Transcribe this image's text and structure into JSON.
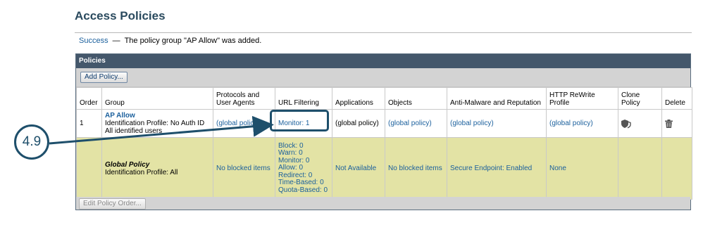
{
  "page": {
    "title": "Access Policies"
  },
  "notice": {
    "label": "Success",
    "separator": "—",
    "message": "The policy group \"AP Allow\" was added."
  },
  "panel": {
    "title": "Policies",
    "add_button": "Add Policy...",
    "edit_order_button": "Edit Policy Order..."
  },
  "table": {
    "columns": {
      "order": "Order",
      "group": "Group",
      "protocols_line1": "Protocols and",
      "protocols_line2": "User Agents",
      "url_filtering": "URL Filtering",
      "applications": "Applications",
      "objects": "Objects",
      "anti_malware": "Anti-Malware and Reputation",
      "http_rewrite": "HTTP ReWrite Profile",
      "clone": "Clone Policy",
      "delete": "Delete"
    },
    "rows": [
      {
        "order": "1",
        "group_name": "AP Allow",
        "identification": "Identification Profile: No Auth ID",
        "users": "All identified users",
        "protocols": "(global policy)",
        "url_filtering": "Monitor: 1",
        "applications": "(global policy)",
        "objects": "(global policy)",
        "anti_malware": "(global policy)",
        "http_rewrite": "(global policy)",
        "clone_icon": "clone-shield-icon",
        "delete_icon": "trash-icon"
      },
      {
        "group_name": "Global Policy",
        "identification": "Identification Profile: All",
        "protocols": "No blocked items",
        "url_filtering": [
          "Block: 0",
          "Warn: 0",
          "Monitor: 0",
          "Allow: 0",
          "Redirect: 0",
          "Time-Based: 0",
          "Quota-Based: 0"
        ],
        "applications": "Not Available",
        "objects": "No blocked items",
        "anti_malware": "Secure Endpoint: Enabled",
        "http_rewrite": "None"
      }
    ]
  },
  "callout": {
    "label": "4.9",
    "color": "#1e4f6b"
  },
  "colors": {
    "header_bg": "#44576b",
    "toolbar_bg": "#d3d3d3",
    "global_row_bg": "#e3e3a5",
    "link": "#1a5f9c",
    "title": "#2a4a5e"
  }
}
